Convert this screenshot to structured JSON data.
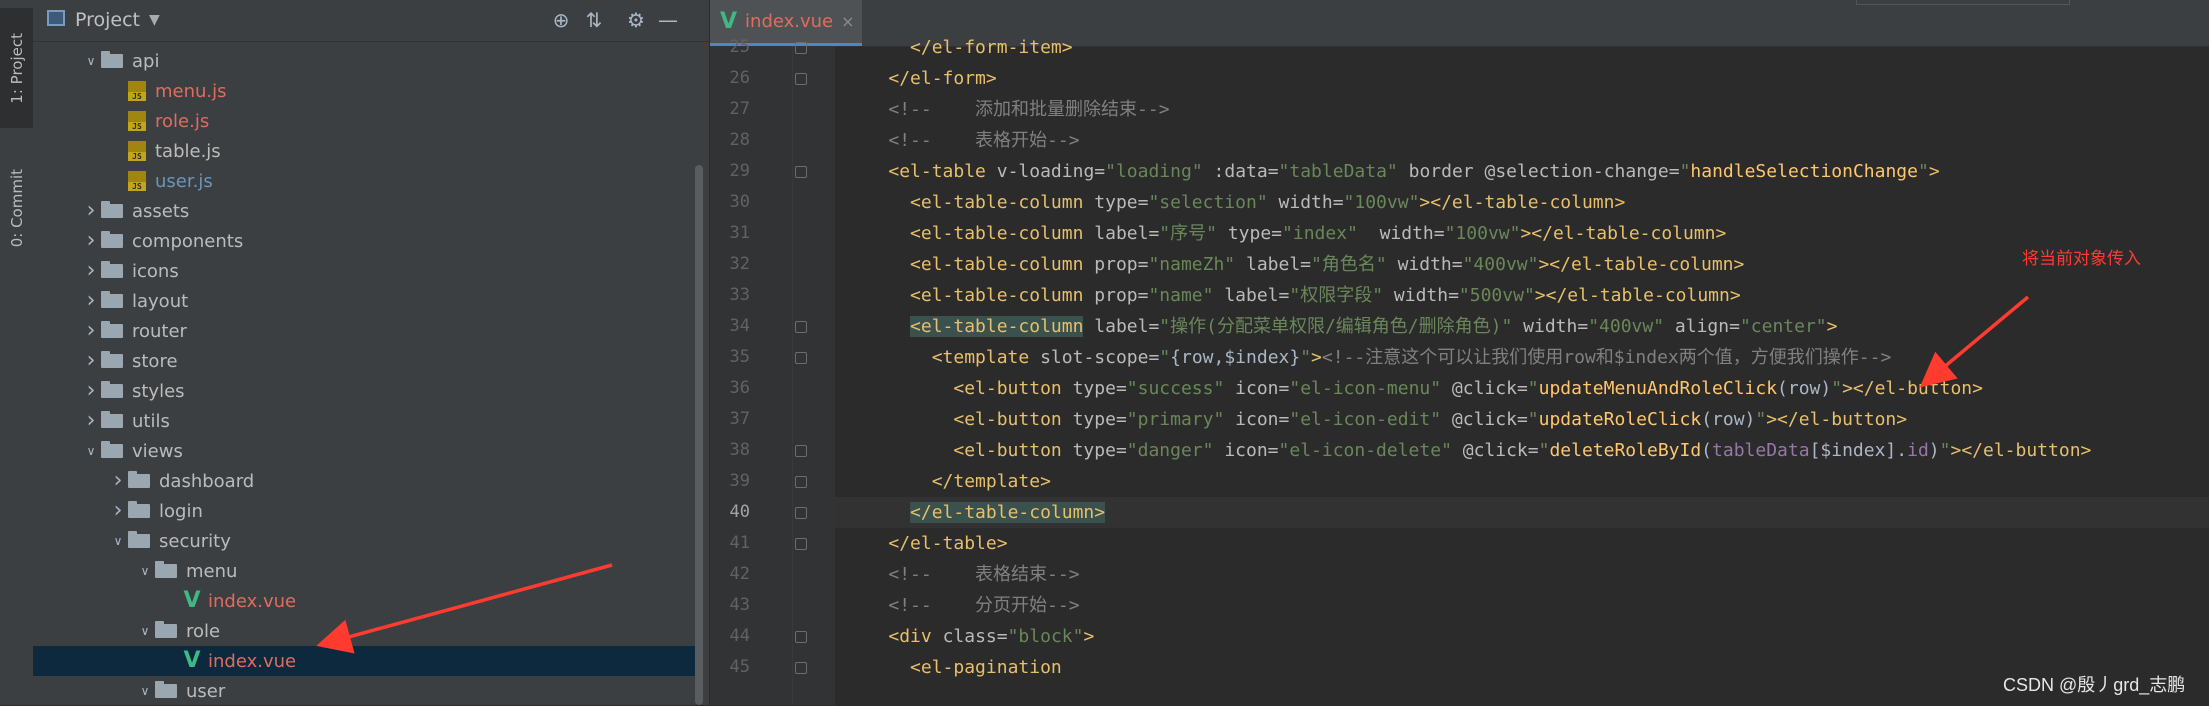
{
  "left_stripe": {
    "project_tab": "1: Project",
    "commit_tab": "0: Commit"
  },
  "project_panel": {
    "title": "Project",
    "tree": [
      {
        "name": "api",
        "type": "folder",
        "state": "open",
        "depth": 2
      },
      {
        "name": "menu.js",
        "type": "js",
        "color": "red",
        "depth": 3
      },
      {
        "name": "role.js",
        "type": "js",
        "color": "red",
        "depth": 3
      },
      {
        "name": "table.js",
        "type": "js",
        "color": "plain",
        "depth": 3
      },
      {
        "name": "user.js",
        "type": "js",
        "color": "blue",
        "depth": 3
      },
      {
        "name": "assets",
        "type": "folder",
        "state": "closed",
        "depth": 2
      },
      {
        "name": "components",
        "type": "folder",
        "state": "closed",
        "depth": 2
      },
      {
        "name": "icons",
        "type": "folder",
        "state": "closed",
        "depth": 2
      },
      {
        "name": "layout",
        "type": "folder",
        "state": "closed",
        "depth": 2
      },
      {
        "name": "router",
        "type": "folder",
        "state": "closed",
        "depth": 2
      },
      {
        "name": "store",
        "type": "folder",
        "state": "closed",
        "depth": 2
      },
      {
        "name": "styles",
        "type": "folder",
        "state": "closed",
        "depth": 2
      },
      {
        "name": "utils",
        "type": "folder",
        "state": "closed",
        "depth": 2
      },
      {
        "name": "views",
        "type": "folder",
        "state": "open",
        "depth": 2
      },
      {
        "name": "dashboard",
        "type": "folder",
        "state": "closed",
        "depth": 3
      },
      {
        "name": "login",
        "type": "folder",
        "state": "closed",
        "depth": 3
      },
      {
        "name": "security",
        "type": "folder",
        "state": "open",
        "depth": 3
      },
      {
        "name": "menu",
        "type": "folder",
        "state": "open",
        "depth": 4
      },
      {
        "name": "index.vue",
        "type": "vue",
        "color": "red",
        "depth": 5
      },
      {
        "name": "role",
        "type": "folder",
        "state": "open",
        "depth": 4
      },
      {
        "name": "index.vue",
        "type": "vue",
        "color": "red",
        "depth": 5,
        "selected": true
      },
      {
        "name": "user",
        "type": "folder",
        "state": "open",
        "depth": 4
      }
    ]
  },
  "editor": {
    "tab": {
      "name": "index.vue",
      "close": "×"
    },
    "current_line": 40,
    "lines": [
      {
        "num": 25,
        "html": "      <span class=\"tg\">&lt;/el-form-item&gt;</span>"
      },
      {
        "num": 26,
        "html": "    <span class=\"tg\">&lt;/el-form&gt;</span>"
      },
      {
        "num": 27,
        "html": "    <span class=\"cm\">&lt;!--    添加和批量删除结束--&gt;</span>"
      },
      {
        "num": 28,
        "html": "    <span class=\"cm\">&lt;!--    表格开始--&gt;</span>"
      },
      {
        "num": 29,
        "html": "    <span class=\"tg\">&lt;el-table</span> <span class=\"at\">v-loading=</span><span class=\"av\">\"loading\"</span> <span class=\"at\">:data=</span><span class=\"av\">\"tableData\"</span> <span class=\"at\">border</span> <span class=\"at\">@selection-change=</span><span class=\"av\">\"</span><span class=\"fn\">handleSelectionChange</span><span class=\"av\">\"</span><span class=\"tg\">&gt;</span>"
      },
      {
        "num": 30,
        "html": "      <span class=\"tg\">&lt;el-table-column</span> <span class=\"at\">type=</span><span class=\"av\">\"selection\"</span> <span class=\"at\">width=</span><span class=\"av\">\"100vw\"</span><span class=\"tg\">&gt;&lt;/el-table-column&gt;</span>"
      },
      {
        "num": 31,
        "html": "      <span class=\"tg\">&lt;el-table-column</span> <span class=\"at\">label=</span><span class=\"av\">\"序号\"</span> <span class=\"at\">type=</span><span class=\"av\">\"index\"</span>  <span class=\"at\">width=</span><span class=\"av\">\"100vw\"</span><span class=\"tg\">&gt;&lt;/el-table-column&gt;</span>"
      },
      {
        "num": 32,
        "html": "      <span class=\"tg\">&lt;el-table-column</span> <span class=\"at\">prop=</span><span class=\"av\">\"nameZh\"</span> <span class=\"at\">label=</span><span class=\"av\">\"角色名\"</span> <span class=\"at\">width=</span><span class=\"av\">\"400vw\"</span><span class=\"tg\">&gt;&lt;/el-table-column&gt;</span>"
      },
      {
        "num": 33,
        "html": "      <span class=\"tg\">&lt;el-table-column</span> <span class=\"at\">prop=</span><span class=\"av\">\"name\"</span> <span class=\"at\">label=</span><span class=\"av\">\"权限字段\"</span> <span class=\"at\">width=</span><span class=\"av\">\"500vw\"</span><span class=\"tg\">&gt;&lt;/el-table-column&gt;</span>"
      },
      {
        "num": 34,
        "html": "      <span class=\"tg hl\">&lt;el-table-column</span> <span class=\"at\">label=</span><span class=\"av\">\"操作(分配菜单权限/编辑角色/删除角色)\"</span> <span class=\"at\">width=</span><span class=\"av\">\"400vw\"</span> <span class=\"at\">align=</span><span class=\"av\">\"center\"</span><span class=\"tg\">&gt;</span>"
      },
      {
        "num": 35,
        "html": "        <span class=\"tg\">&lt;template</span> <span class=\"at\">slot-scope=</span><span class=\"av\">\"</span>{row,$index}<span class=\"av\">\"</span><span class=\"tg\">&gt;</span><span class=\"cm\">&lt;!--注意这个可以让我们使用row和$index两个值，方便我们操作--&gt;</span>"
      },
      {
        "num": 36,
        "html": "          <span class=\"tg\">&lt;el-button</span> <span class=\"at\">type=</span><span class=\"av\">\"success\"</span> <span class=\"at\">icon=</span><span class=\"av\">\"el-icon-menu\"</span> <span class=\"at\">@click=</span><span class=\"av\">\"</span><span class=\"fn\">updateMenuAndRoleClick</span>(row)<span class=\"av\">\"</span><span class=\"tg\">&gt;&lt;/el-button&gt;</span>"
      },
      {
        "num": 37,
        "html": "          <span class=\"tg\">&lt;el-button</span> <span class=\"at\">type=</span><span class=\"av\">\"primary\"</span> <span class=\"at\">icon=</span><span class=\"av\">\"el-icon-edit\"</span> <span class=\"at\">@click=</span><span class=\"av\">\"</span><span class=\"fn\">updateRoleClick</span>(row)<span class=\"av\">\"</span><span class=\"tg\">&gt;&lt;/el-button&gt;</span>"
      },
      {
        "num": 38,
        "html": "          <span class=\"tg\">&lt;el-button</span> <span class=\"at\">type=</span><span class=\"av\">\"danger\"</span> <span class=\"at\">icon=</span><span class=\"av\">\"el-icon-delete\"</span> <span class=\"at\">@click=</span><span class=\"av\">\"</span><span class=\"fn\">deleteRoleById</span>(<span class=\"vr\">tableData</span>[$index].<span class=\"vr\">id</span>)<span class=\"av\">\"</span><span class=\"tg\">&gt;&lt;/el-button&gt;</span>"
      },
      {
        "num": 39,
        "html": "        <span class=\"tg\">&lt;/template&gt;</span>"
      },
      {
        "num": 40,
        "html": "      <span class=\"tg hl\">&lt;/el-table-column&gt;</span>"
      },
      {
        "num": 41,
        "html": "    <span class=\"tg\">&lt;/el-table&gt;</span>"
      },
      {
        "num": 42,
        "html": "    <span class=\"cm\">&lt;!--    表格结束--&gt;</span>"
      },
      {
        "num": 43,
        "html": "    <span class=\"cm\">&lt;!--    分页开始--&gt;</span>"
      },
      {
        "num": 44,
        "html": "    <span class=\"tg\">&lt;div</span> <span class=\"at\">class=</span><span class=\"av\">\"block\"</span><span class=\"tg\">&gt;</span>"
      },
      {
        "num": 45,
        "html": "      <span class=\"tg\">&lt;el-pagination</span>"
      }
    ]
  },
  "annotation": "将当前对象传入",
  "watermark": "CSDN @殷丿grd_志鹏",
  "colors": {
    "annotation_arrow": "#ff3b30",
    "vue_icon": "#41b883",
    "modified_file": "#e06c5e",
    "selected_row": "#0d293e"
  }
}
